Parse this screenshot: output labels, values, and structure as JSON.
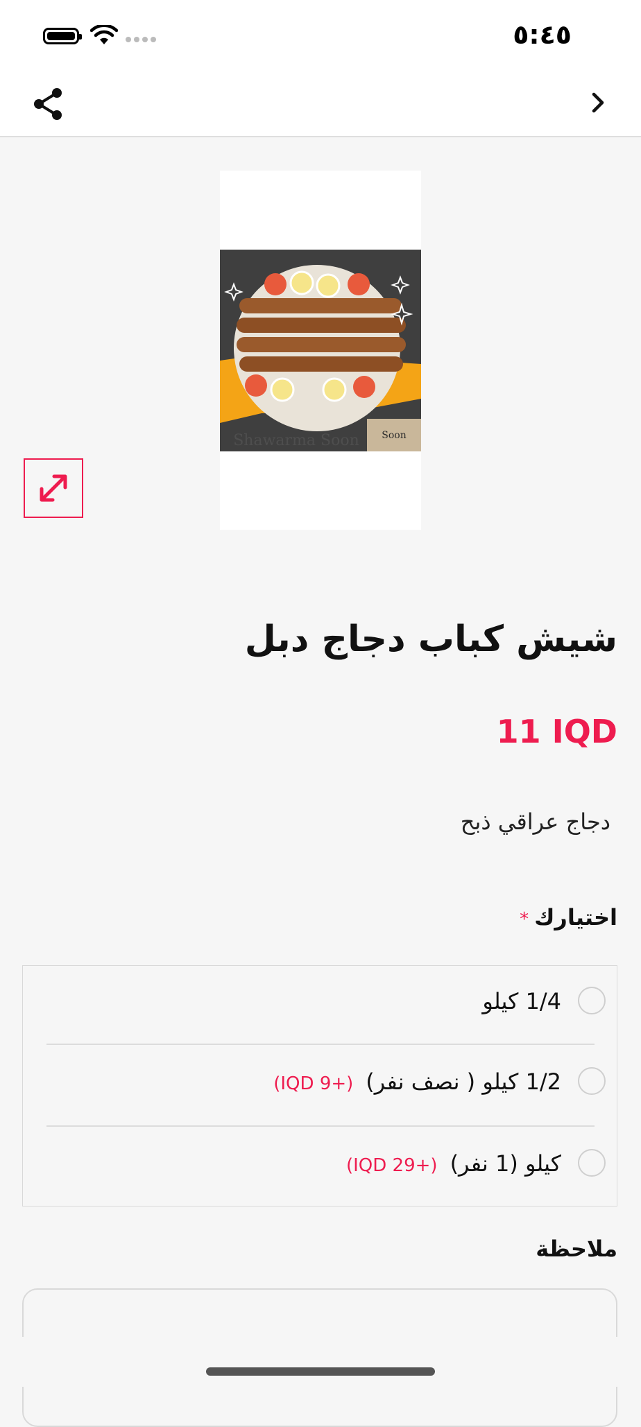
{
  "status_bar": {
    "time": "٥:٤٥"
  },
  "product": {
    "title": "شيش كباب دجاج دبل",
    "price": "11 IQD",
    "description": "دجاج عراقي ذبح",
    "image_alt": "food-photo",
    "brand_text": "Shawarma Soon"
  },
  "options": {
    "label": "اختيارك",
    "required_mark": "*",
    "items": [
      {
        "label": "1/4 كيلو",
        "extra": ""
      },
      {
        "label": "1/2 كيلو ( نصف نفر)",
        "extra": "(+9 IQD)"
      },
      {
        "label": "كيلو (1 نفر)",
        "extra": "(+29 IQD)"
      }
    ]
  },
  "note": {
    "label": "ملاحظة",
    "placeholder": ""
  },
  "colors": {
    "accent": "#ee1c4f",
    "background": "#f6f6f6"
  },
  "icons": {
    "share": "share-icon",
    "back": "chevron-right-icon",
    "expand": "expand-icon"
  }
}
